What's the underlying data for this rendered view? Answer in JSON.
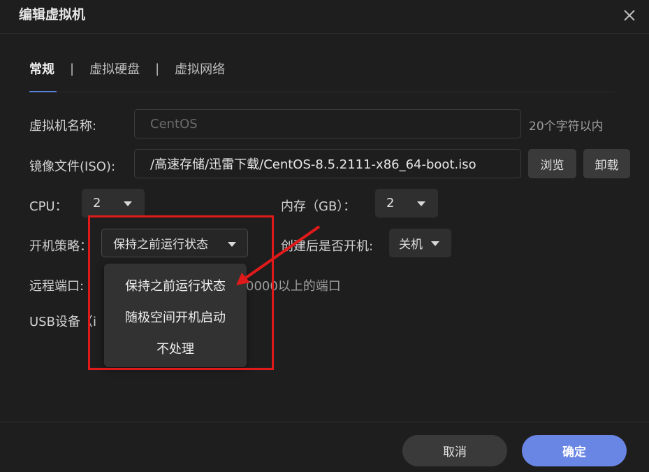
{
  "dialog": {
    "title": "编辑虚拟机",
    "close_icon": "close-icon"
  },
  "tabs": [
    {
      "label": "常规",
      "active": true
    },
    {
      "label": "虚拟硬盘",
      "active": false
    },
    {
      "label": "虚拟网络",
      "active": false
    }
  ],
  "tab_separator": "|",
  "form": {
    "vm_name": {
      "label": "虚拟机名称:",
      "value": "CentOS",
      "hint": "20个字符以内"
    },
    "iso": {
      "label": "镜像文件(ISO):",
      "value": "/高速存储/迅雷下载/CentOS-8.5.2111-x86_64-boot.iso",
      "browse_label": "浏览",
      "unmount_label": "卸载"
    },
    "cpu": {
      "label": "CPU：",
      "value": "2"
    },
    "memory": {
      "label": "内存（GB）：",
      "value": "2"
    },
    "boot_policy": {
      "label": "开机策略：",
      "value": "保持之前运行状态",
      "options": [
        "保持之前运行状态",
        "随极空间开机启动",
        "不处理"
      ]
    },
    "power_on_after_create": {
      "label": "创建后是否开机:",
      "value": "关机"
    },
    "remote_port": {
      "label": "远程端口:",
      "hint_visible": "0000以上的端口"
    },
    "usb": {
      "label": "USB设备（i"
    }
  },
  "footer": {
    "cancel_label": "取消",
    "ok_label": "确定"
  },
  "colors": {
    "background": "#1e1e1e",
    "accent": "#6a86e4",
    "annotation": "#e01a1a"
  }
}
